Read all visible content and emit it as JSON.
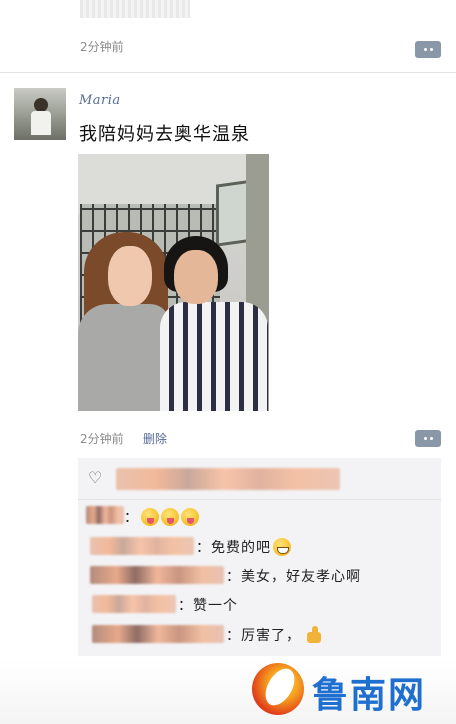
{
  "previous_post": {
    "time": "2分钟前"
  },
  "post": {
    "username": "Maria",
    "text": "我陪妈妈去奥华温泉",
    "time": "2分钟前",
    "delete_label": "删除"
  },
  "likes": {
    "icon": "heart-outline-icon"
  },
  "comments": [
    {
      "text": "：",
      "emojis": [
        "squinting-tongue-icon",
        "squinting-tongue-icon",
        "squinting-tongue-icon"
      ]
    },
    {
      "text": "：免费的吧",
      "emojis": [
        "grinning-face-icon"
      ]
    },
    {
      "text": "：美女，好友孝心啊",
      "emojis": []
    },
    {
      "text": "：赞一个",
      "emojis": []
    },
    {
      "text": "：厉害了，",
      "emojis": [
        "thumbs-up-icon"
      ]
    }
  ],
  "watermark": {
    "text": "鲁南网",
    "color": "#1f6fd1"
  },
  "colors": {
    "link_blue": "#576b95",
    "comment_bg": "#f3f3f5",
    "more_button": "#8a97a8"
  }
}
